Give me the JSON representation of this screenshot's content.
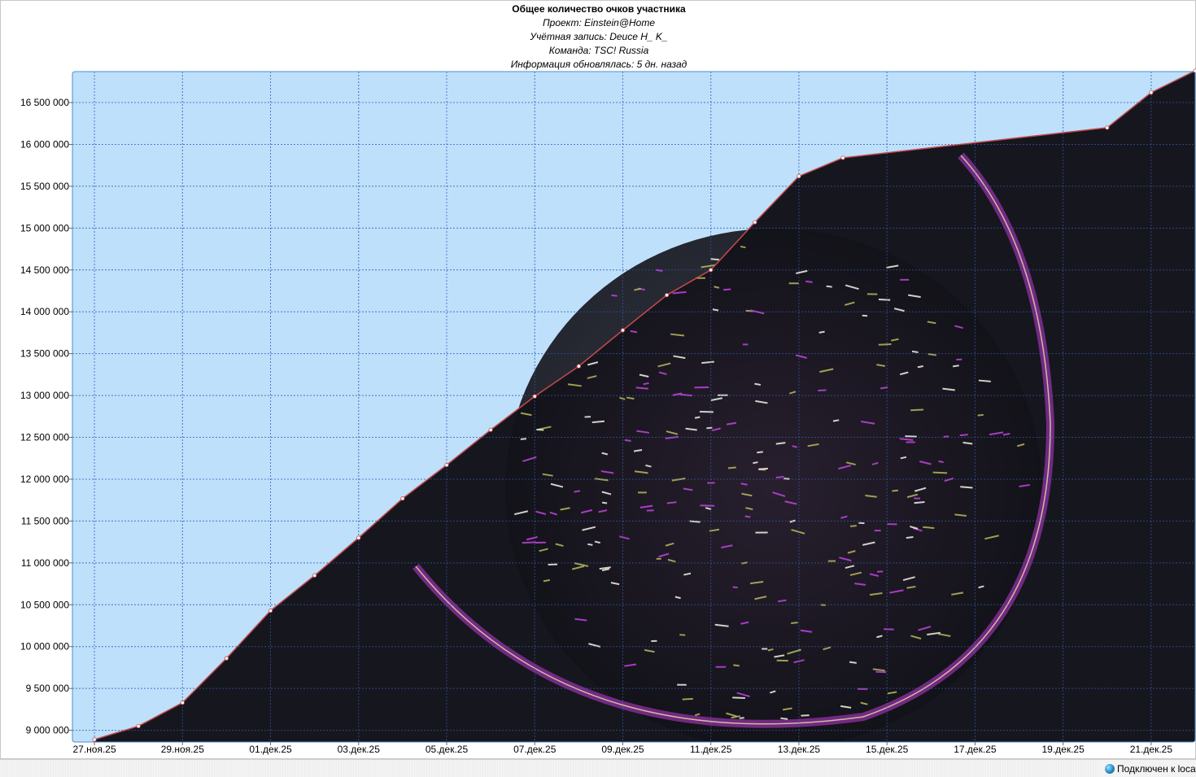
{
  "chart_data": {
    "type": "area",
    "title": "Общее количество очков участника",
    "subtitle_lines": [
      "Проект: Einstein@Home",
      "Учётная запись: Deuce H_ K_",
      "Команда: TSC! Russia",
      "Информация обновлялась: 5 дн. назад"
    ],
    "xlabel": "",
    "ylabel": "",
    "grid": true,
    "legend": "none",
    "x_ticks": [
      "27.ноя.25",
      "29.ноя.25",
      "01.дек.25",
      "03.дек.25",
      "05.дек.25",
      "07.дек.25",
      "09.дек.25",
      "11.дек.25",
      "13.дек.25",
      "15.дек.25",
      "17.дек.25",
      "19.дек.25",
      "21.дек.25"
    ],
    "x_tick_days": [
      0,
      2,
      4,
      6,
      8,
      10,
      12,
      14,
      16,
      18,
      20,
      22,
      24
    ],
    "y_ticks": [
      "9 000 000",
      "9 500 000",
      "10 000 000",
      "10 500 000",
      "11 000 000",
      "11 500 000",
      "12 000 000",
      "12 500 000",
      "13 000 000",
      "13 500 000",
      "14 000 000",
      "14 500 000",
      "15 000 000",
      "15 500 000",
      "16 000 000",
      "16 500 000"
    ],
    "y_tick_values": [
      9000000,
      9500000,
      10000000,
      10500000,
      11000000,
      11500000,
      12000000,
      12500000,
      13000000,
      13500000,
      14000000,
      14500000,
      15000000,
      15500000,
      16000000,
      16500000
    ],
    "ylim": [
      8860000,
      16870000
    ],
    "xlim_days": [
      -0.5,
      25
    ],
    "x": [
      "27.ноя.25",
      "28.ноя.25",
      "29.ноя.25",
      "30.ноя.25",
      "01.дек.25",
      "02.дек.25",
      "03.дек.25",
      "04.дек.25",
      "05.дек.25",
      "06.дек.25",
      "07.дек.25",
      "08.дек.25",
      "09.дек.25",
      "10.дек.25",
      "11.дек.25",
      "12.дек.25",
      "13.дек.25",
      "14.дек.25",
      "20.дек.25",
      "21.дек.25",
      "22.дек.25"
    ],
    "x_days": [
      0,
      1,
      2,
      3,
      4,
      5,
      6,
      7,
      8,
      9,
      10,
      11,
      12,
      13,
      14,
      15,
      16,
      17,
      23,
      24,
      25
    ],
    "series": [
      {
        "values": [
          8890000,
          9050000,
          9330000,
          9860000,
          10430000,
          10850000,
          11300000,
          11770000,
          12170000,
          12590000,
          12990000,
          13350000,
          13780000,
          14200000,
          14500000,
          15070000,
          15620000,
          15840000,
          16200000,
          16620000,
          16880000
        ]
      }
    ],
    "colors": {
      "plot_background": "#bfe0fb",
      "fill": "#16161f",
      "line": "#c44a4a",
      "grid": "#3f6fc0",
      "frame": "#4a90c8"
    },
    "fill_texture": "starfield image with purple and yellow streaks"
  },
  "status_bar": {
    "connection": "Подключен к localhost"
  }
}
